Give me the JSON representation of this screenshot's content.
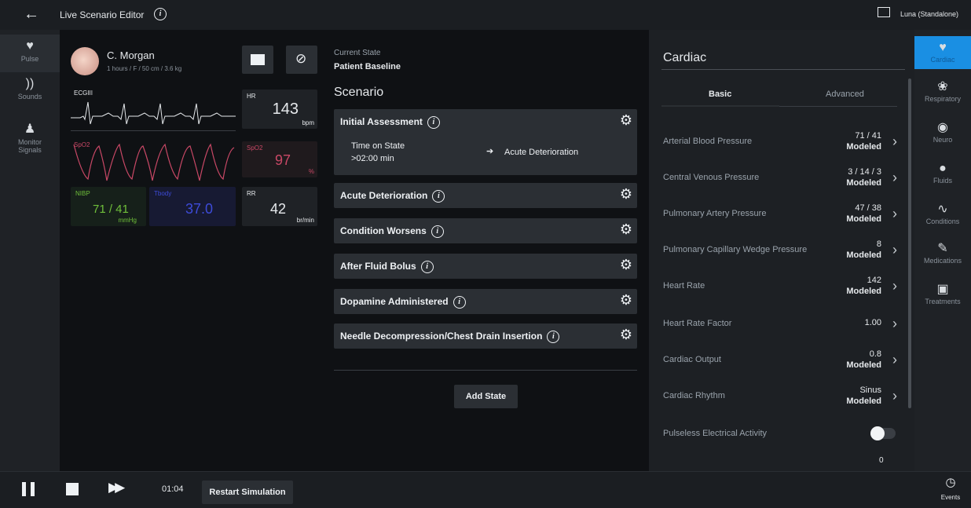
{
  "topbar": {
    "title": "Live Scenario Editor",
    "user": "Luna (Standalone)"
  },
  "leftnav": {
    "items": [
      {
        "label": "Pulse",
        "icon": "heart-pulse-icon"
      },
      {
        "label": "Sounds",
        "icon": "sound-icon"
      },
      {
        "label": "Monitor Signals",
        "icon": "monitor-signals-icon"
      }
    ]
  },
  "patient": {
    "name": "C. Morgan",
    "details": "1 hours / F / 50 cm / 3.6 kg"
  },
  "vitals": {
    "ecg_label": "ECGIII",
    "hr_label": "HR",
    "hr_value": "143",
    "hr_unit": "bpm",
    "spo2_label": "SpO2",
    "spo2_box_label": "SpO2",
    "spo2_value": "97",
    "spo2_unit": "%",
    "nibp_label": "NIBP",
    "nibp_value": "71 / 41",
    "nibp_unit": "mmHg",
    "temp_label": "Tbody",
    "temp_value": "37.0",
    "rr_label": "RR",
    "rr_value": "42",
    "rr_unit": "br/min"
  },
  "current_state": {
    "label": "Current State",
    "value": "Patient Baseline"
  },
  "scenario": {
    "title": "Scenario",
    "states": [
      {
        "name": "Initial Assessment",
        "time_label": "Time on State",
        "time_value": ">02:00 min",
        "transition": "Acute Deterioration"
      },
      {
        "name": "Acute Deterioration"
      },
      {
        "name": "Condition Worsens"
      },
      {
        "name": "After Fluid Bolus"
      },
      {
        "name": "Dopamine Administered"
      },
      {
        "name": "Needle Decompression/Chest Drain Insertion"
      }
    ],
    "add_state": "Add State"
  },
  "cardiac": {
    "title": "Cardiac",
    "tabs": [
      "Basic",
      "Advanced"
    ],
    "params": [
      {
        "name": "Arterial Blood Pressure",
        "value": "71 / 41",
        "mode": "Modeled"
      },
      {
        "name": "Central Venous Pressure",
        "value": "3 / 14 / 3",
        "mode": "Modeled"
      },
      {
        "name": "Pulmonary Artery Pressure",
        "value": "47 / 38",
        "mode": "Modeled"
      },
      {
        "name": "Pulmonary Capillary Wedge Pressure",
        "value": "8",
        "mode": "Modeled"
      },
      {
        "name": "Heart Rate",
        "value": "142",
        "mode": "Modeled"
      },
      {
        "name": "Heart Rate Factor",
        "value": "1.00",
        "mode": ""
      },
      {
        "name": "Cardiac Output",
        "value": "0.8",
        "mode": "Modeled"
      },
      {
        "name": "Cardiac Rhythm",
        "value": "Sinus",
        "mode": "Modeled"
      }
    ],
    "pea_label": "Pulseless Electrical Activity",
    "cut_value": "0"
  },
  "rightnav": {
    "items": [
      {
        "label": "Cardiac"
      },
      {
        "label": "Respiratory"
      },
      {
        "label": "Neuro"
      },
      {
        "label": "Fluids"
      },
      {
        "label": "Conditions"
      },
      {
        "label": "Medications"
      },
      {
        "label": "Treatments"
      }
    ]
  },
  "bottombar": {
    "time": "01:04",
    "restart": "Restart Simulation",
    "events": "Events"
  },
  "colors": {
    "accent": "#1a8fe3",
    "ecg": "#7fd37f",
    "spo2": "#c94866",
    "nibp": "#6fbf3a",
    "temp": "#3d4bd8"
  }
}
